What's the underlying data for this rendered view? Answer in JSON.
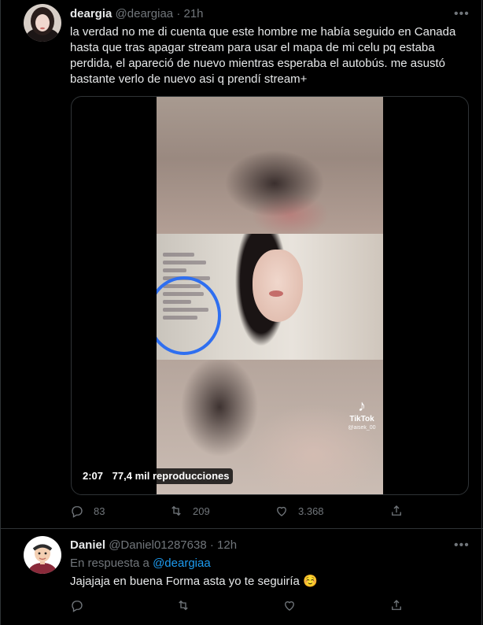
{
  "tweet": {
    "display_name": "deargia",
    "handle": "@deargiaa",
    "separator": "·",
    "time": "21h",
    "text": "la verdad no me di cuenta que este hombre me había seguido en Canada hasta que tras apagar stream para usar el mapa de mi celu pq estaba perdida, el apareció de nuevo mientras esperaba el autobús. me asustó bastante verlo de nuevo asi q prendí stream+",
    "video": {
      "duration": "2:07",
      "views": "77,4 mil reproducciones",
      "watermark_brand": "TikTok",
      "watermark_handle": "@aisek_00"
    },
    "actions": {
      "replies": "83",
      "retweets": "209",
      "likes": "3.368"
    }
  },
  "reply": {
    "display_name": "Daniel",
    "handle": "@Daniel01287638",
    "separator": "·",
    "time": "12h",
    "replying_prefix": "En respuesta a",
    "replying_to": "@deargiaa",
    "text": "Jajajaja en buena Forma asta yo te seguiría ☺️"
  },
  "icons": {
    "more": "more-horizontal-icon",
    "reply": "reply-icon",
    "retweet": "retweet-icon",
    "like": "heart-icon",
    "share": "share-icon"
  },
  "colors": {
    "background": "#000000",
    "text": "#e7e9ea",
    "muted": "#71767b",
    "link": "#1d9bf0",
    "border": "#2f3336"
  }
}
